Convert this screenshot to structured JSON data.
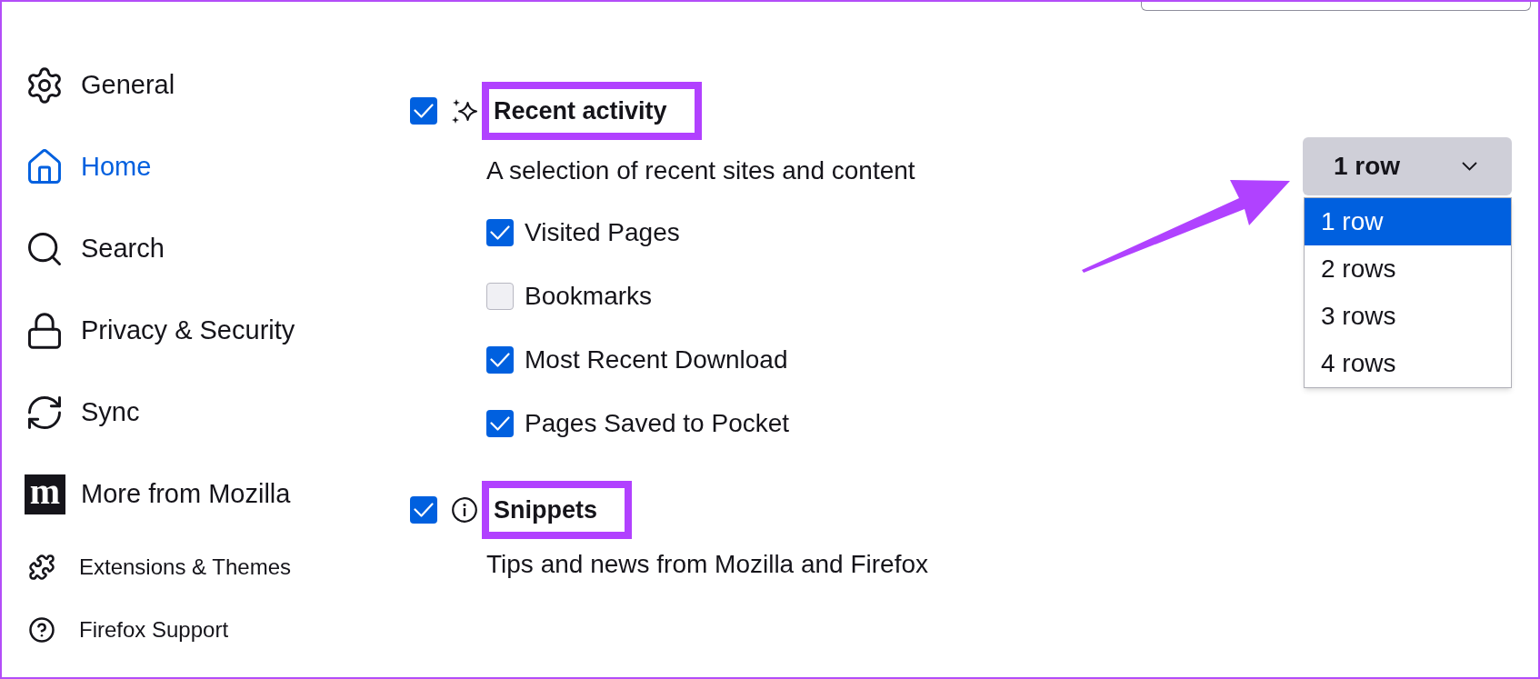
{
  "sidebar": {
    "items": [
      {
        "label": "General",
        "kind": "category",
        "selected": false
      },
      {
        "label": "Home",
        "kind": "category",
        "selected": true
      },
      {
        "label": "Search",
        "kind": "category",
        "selected": false
      },
      {
        "label": "Privacy & Security",
        "kind": "category",
        "selected": false
      },
      {
        "label": "Sync",
        "kind": "category",
        "selected": false
      },
      {
        "label": "More from Mozilla",
        "kind": "category",
        "selected": false,
        "logo_text": "m"
      },
      {
        "label": "Extensions & Themes",
        "kind": "link",
        "selected": false
      },
      {
        "label": "Firefox Support",
        "kind": "link",
        "selected": false
      }
    ]
  },
  "sections": [
    {
      "label": "Recent activity",
      "checked": true,
      "highlighted": true,
      "description": "A selection of recent sites and content",
      "select": {
        "value": "1 row",
        "expanded": true,
        "options": [
          {
            "label": "1 row",
            "selected": true
          },
          {
            "label": "2 rows",
            "selected": false
          },
          {
            "label": "3 rows",
            "selected": false
          },
          {
            "label": "4 rows",
            "selected": false
          }
        ]
      },
      "items": [
        {
          "label": "Visited Pages",
          "checked": true
        },
        {
          "label": "Bookmarks",
          "checked": false
        },
        {
          "label": "Most Recent Download",
          "checked": true
        },
        {
          "label": "Pages Saved to Pocket",
          "checked": true
        }
      ]
    },
    {
      "label": "Snippets",
      "checked": true,
      "highlighted": true,
      "description": "Tips and news from Mozilla and Firefox"
    }
  ]
}
